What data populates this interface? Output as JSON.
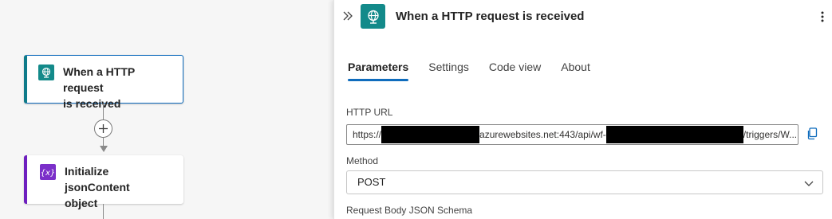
{
  "canvas": {
    "cards": [
      {
        "title": "When a HTTP request is received",
        "title_lines": [
          "When a HTTP request",
          "is received"
        ],
        "icon": "http-request-globe-icon",
        "accent": "#138a8a"
      },
      {
        "title": "Initialize jsonContent object",
        "title_lines": [
          "Initialize jsonContent",
          "object"
        ],
        "icon": "variable-braces-icon",
        "accent": "#7b2fc9"
      }
    ],
    "add_step_icon": "plus-circle-icon"
  },
  "panel": {
    "header": {
      "title": "When a HTTP request is received",
      "icon": "http-request-globe-icon",
      "collapse_icon": "double-chevron-right-icon",
      "more_icon": "more-vertical-icon"
    },
    "tabs": [
      {
        "label": "Parameters",
        "active": true
      },
      {
        "label": "Settings",
        "active": false
      },
      {
        "label": "Code view",
        "active": false
      },
      {
        "label": "About",
        "active": false
      }
    ],
    "http_url": {
      "label": "HTTP URL",
      "value_part1": "https://",
      "value_part2": "azurewebsites.net:443/api/wf-",
      "value_part3": "/triggers/W...",
      "copy_icon": "copy-icon"
    },
    "method": {
      "label": "Method",
      "value": "POST",
      "chevron_icon": "chevron-down-icon"
    },
    "request_body": {
      "label": "Request Body JSON Schema"
    }
  },
  "colors": {
    "accent_blue": "#0f6cbd",
    "trigger_teal": "#138a8a",
    "variable_purple": "#7b2fc9"
  }
}
